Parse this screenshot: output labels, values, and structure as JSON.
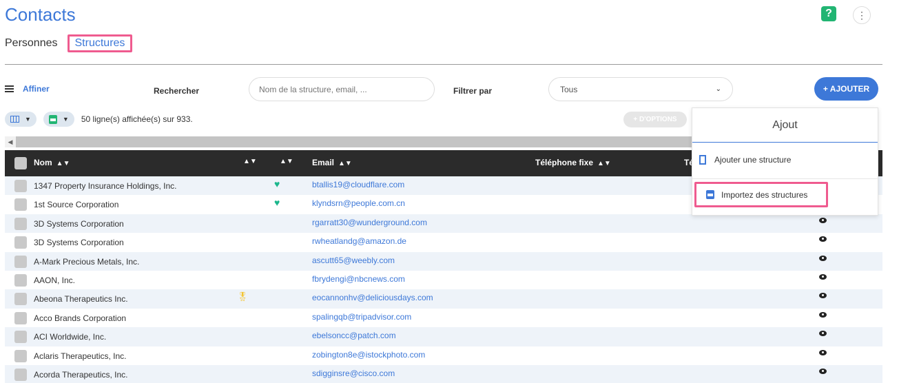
{
  "page": {
    "title": "Contacts"
  },
  "tabs": [
    {
      "label": "Personnes",
      "active": false
    },
    {
      "label": "Structures",
      "active": true
    }
  ],
  "filters": {
    "affiner_label": "Affiner",
    "search_label": "Rechercher",
    "search_placeholder": "Nom de la structure, email, ...",
    "filter_label": "Filtrer par",
    "filter_value": "Tous",
    "add_button": "+ AJOUTER"
  },
  "toolbar": {
    "count_text": "50 ligne(s) affichée(s) sur 933.",
    "options_button": "+ D'OPTIONS"
  },
  "table": {
    "columns": [
      "Nom",
      "Email",
      "Téléphone fixe",
      "Té"
    ],
    "rows": [
      {
        "name": "1347 Property Insurance Holdings, Inc.",
        "email": "btallis19@cloudflare.com",
        "icon": "heart"
      },
      {
        "name": "1st Source Corporation",
        "email": "klyndsrn@people.com.cn",
        "icon": "heart"
      },
      {
        "name": "3D Systems Corporation",
        "email": "rgarratt30@wunderground.com",
        "icon": ""
      },
      {
        "name": "3D Systems Corporation",
        "email": "rwheatlandg@amazon.de",
        "icon": ""
      },
      {
        "name": "A-Mark Precious Metals, Inc.",
        "email": "ascutt65@weebly.com",
        "icon": ""
      },
      {
        "name": "AAON, Inc.",
        "email": "fbrydengi@nbcnews.com",
        "icon": ""
      },
      {
        "name": "Abeona Therapeutics Inc.",
        "email": "eocannonhv@deliciousdays.com",
        "icon": "medal"
      },
      {
        "name": "Acco Brands Corporation",
        "email": "spalingqb@tripadvisor.com",
        "icon": ""
      },
      {
        "name": "ACI Worldwide, Inc.",
        "email": "ebelsoncc@patch.com",
        "icon": ""
      },
      {
        "name": "Aclaris Therapeutics, Inc.",
        "email": "zobington8e@istockphoto.com",
        "icon": ""
      },
      {
        "name": "Acorda Therapeutics, Inc.",
        "email": "sdigginsre@cisco.com",
        "icon": ""
      }
    ]
  },
  "dropdown": {
    "title": "Ajout",
    "items": [
      "Ajouter une structure",
      "Importez des structures"
    ]
  },
  "colors": {
    "accent": "#3d78d8",
    "highlight": "#ef5b8f",
    "success": "#22b573"
  },
  "icons": [
    "help-icon",
    "kebab-menu-icon",
    "hamburger-icon",
    "columns-icon",
    "csv-export-icon",
    "heart-icon",
    "medal-icon",
    "eye-icon",
    "building-icon",
    "csv-import-icon"
  ]
}
